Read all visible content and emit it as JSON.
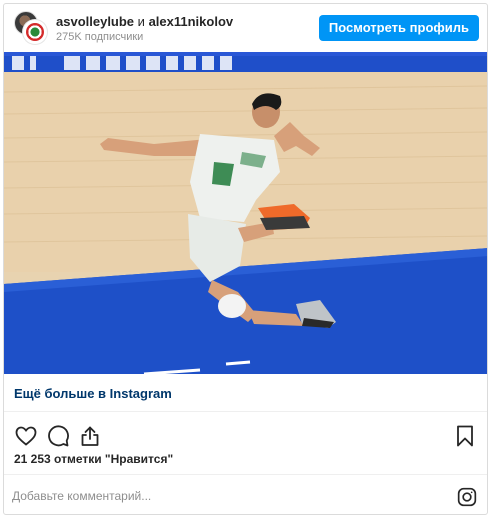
{
  "header": {
    "user_1": "asvolleylube",
    "conjunction": "и",
    "user_2": "alex11nikolov",
    "followers": "275K подписчики",
    "view_profile_label": "Посмотреть профиль"
  },
  "photo": {
    "description_icon": "volleyball-player-image"
  },
  "more_link": "Ещё больше в Instagram",
  "actions": {
    "like_icon": "heart-icon",
    "comment_icon": "comment-icon",
    "share_icon": "share-icon",
    "save_icon": "bookmark-icon"
  },
  "likes_text": "21 253 отметки \"Нравится\"",
  "comment": {
    "placeholder": "Добавьте комментарий..."
  },
  "colors": {
    "accent": "#0095f6",
    "link": "#00376b",
    "muted": "#8e8e8e"
  }
}
